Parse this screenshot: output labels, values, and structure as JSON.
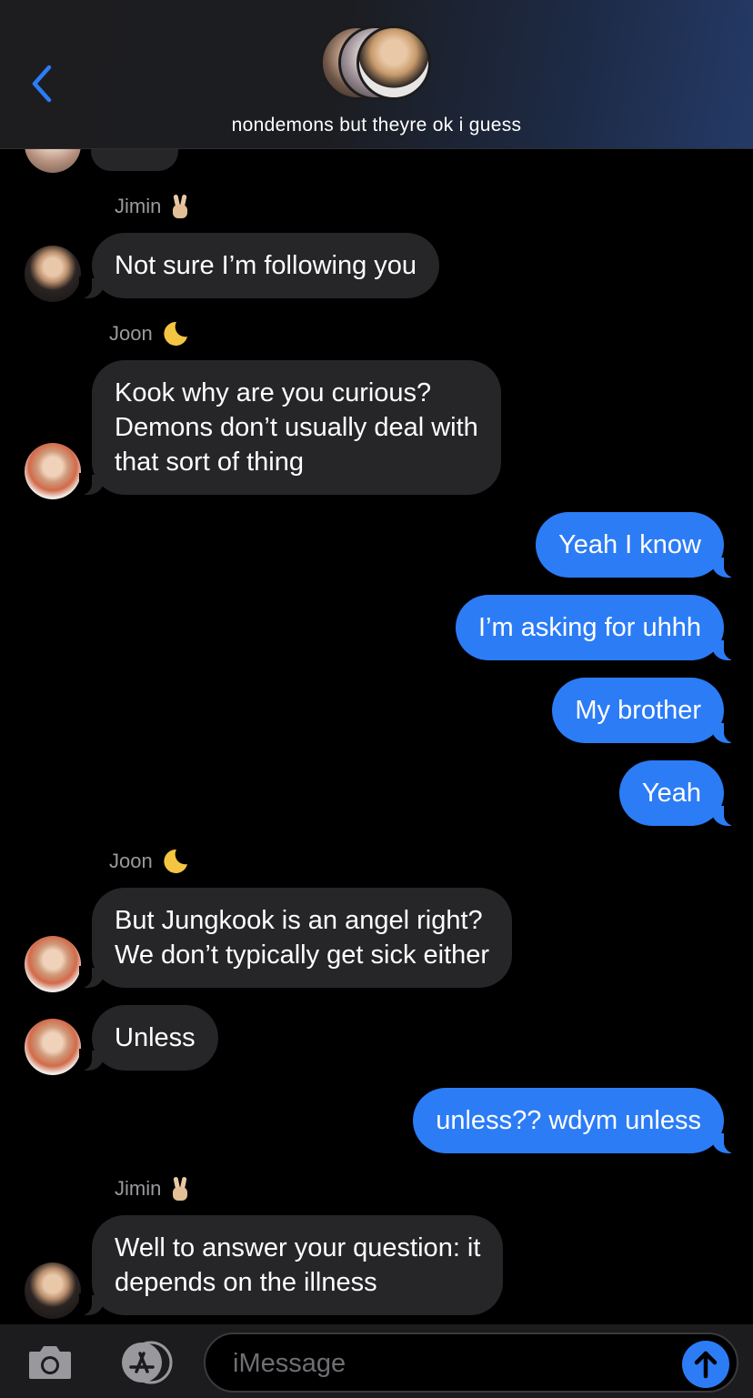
{
  "header": {
    "group_name": "nondemons but theyre ok i guess",
    "back_icon": "chevron-left-icon",
    "accent": "#2c7cf6"
  },
  "messages": [
    {
      "sender": "Jimin",
      "sender_emoji": "victory-hand-icon",
      "text": "Not sure I’m following you",
      "direction": "incoming"
    },
    {
      "sender": "Joon",
      "sender_emoji": "crescent-moon-icon",
      "text_lines": [
        "Kook why are you curious?",
        "Demons don’t usually deal with",
        "that sort of thing"
      ],
      "direction": "incoming"
    },
    {
      "text": "Yeah I know",
      "direction": "outgoing"
    },
    {
      "text": "I’m asking for uhhh",
      "direction": "outgoing"
    },
    {
      "text": "My brother",
      "direction": "outgoing"
    },
    {
      "text": "Yeah",
      "direction": "outgoing"
    },
    {
      "sender": "Joon",
      "sender_emoji": "crescent-moon-icon",
      "text_lines": [
        "But Jungkook is an angel right?",
        "We don’t typically get sick either"
      ],
      "direction": "incoming"
    },
    {
      "text": "Unless",
      "direction": "incoming"
    },
    {
      "text": "unless?? wdym unless",
      "direction": "outgoing"
    },
    {
      "sender": "Jimin",
      "sender_emoji": "victory-hand-icon",
      "text_lines": [
        "Well to answer your question: it",
        "depends on the illness"
      ],
      "direction": "incoming"
    }
  ],
  "input": {
    "placeholder": "iMessage",
    "value": "",
    "camera_icon": "camera-icon",
    "apps_icon": "app-store-icon",
    "send_icon": "arrow-up-icon"
  },
  "colors": {
    "incoming_bubble": "#262628",
    "outgoing_bubble": "#2c7cf6",
    "background": "#000000"
  }
}
